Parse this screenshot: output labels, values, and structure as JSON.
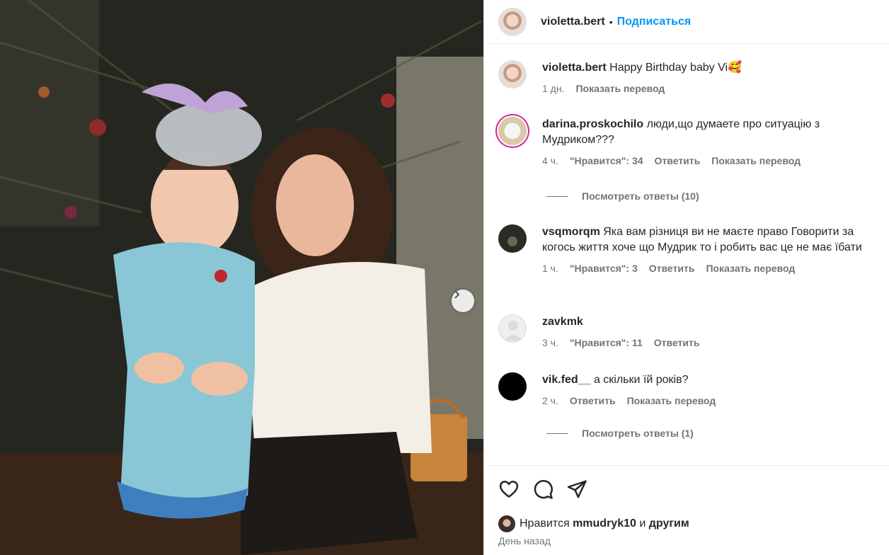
{
  "post": {
    "username": "violetta.bert",
    "separator": "•",
    "follow_label": "Подписаться"
  },
  "caption": {
    "username": "violetta.bert",
    "text": "Happy Birthday baby Vi🥰",
    "time": "1 дн.",
    "translate": "Показать перевод"
  },
  "comments": [
    {
      "username": "darina.proskochilo",
      "text": "люди,що думаете про ситуацію з Мудриком???",
      "time": "4 ч.",
      "likes": "\"Нравится\": 34",
      "reply": "Ответить",
      "translate": "Показать перевод",
      "view_replies": "Посмотреть ответы (10)"
    },
    {
      "username": "vsqmorqm",
      "text": "Яка вам різниця ви не маєте право Говорити за когось життя хоче що Мудрик то і робить вас це не має їбати",
      "time": "1 ч.",
      "likes": "\"Нравится\": 3",
      "reply": "Ответить",
      "translate": "Показать перевод"
    },
    {
      "username": "zavkmk",
      "text": "",
      "time": "3 ч.",
      "likes": "\"Нравится\": 11",
      "reply": "Ответить"
    },
    {
      "username": "vik.fed__",
      "text": "а скільки їй років?",
      "time": "2 ч.",
      "reply": "Ответить",
      "translate": "Показать перевод",
      "view_replies": "Посмотреть ответы (1)"
    }
  ],
  "actions": {
    "like_icon": "heart-icon",
    "comment_icon": "comment-icon",
    "share_icon": "share-icon"
  },
  "likes": {
    "prefix": "Нравится",
    "user": "mmudryk10",
    "joiner": "и",
    "others": "другим"
  },
  "posted": "День назад",
  "colors": {
    "link": "#0095f6",
    "secondary_text": "#737373",
    "border": "#efefef",
    "story_ring": "#d6249f"
  }
}
